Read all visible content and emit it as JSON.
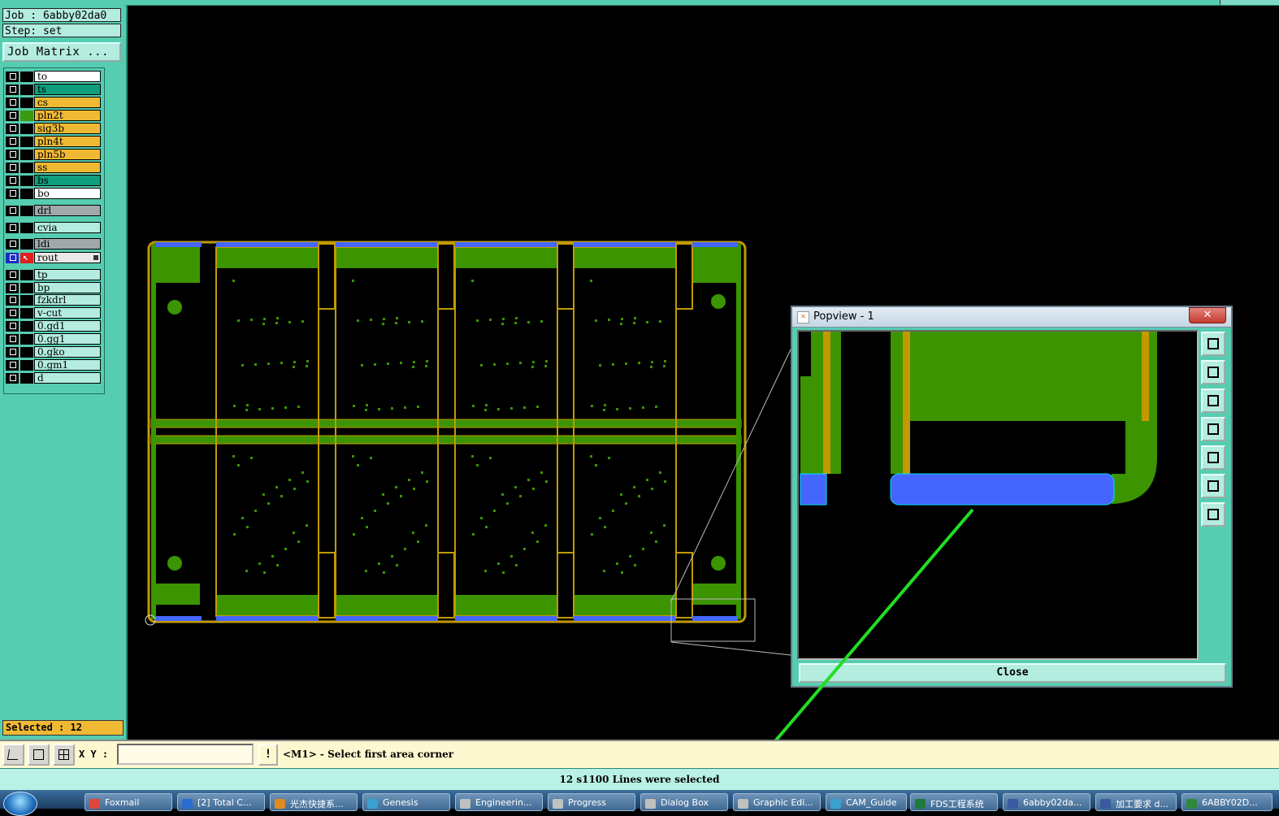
{
  "header": {
    "job_label": "Job : 6abby02da0",
    "step_label": "Step: set",
    "job_matrix_button": "Job Matrix ..."
  },
  "layers": [
    {
      "name": "to",
      "color": "#ffffff"
    },
    {
      "name": "ts",
      "color": "#0f9e7e"
    },
    {
      "name": "cs",
      "color": "#f0b934"
    },
    {
      "name": "pln2t",
      "color": "#f0b934",
      "swatch": "#3a9a10"
    },
    {
      "name": "sig3b",
      "color": "#f0b934"
    },
    {
      "name": "pln4t",
      "color": "#f0b934"
    },
    {
      "name": "pln5b",
      "color": "#f0b934"
    },
    {
      "name": "ss",
      "color": "#f0b934"
    },
    {
      "name": "bs",
      "color": "#0f9e7e"
    },
    {
      "name": "bo",
      "color": "#ffffff"
    },
    {
      "name": "drl",
      "color": "#a0a8aa"
    },
    {
      "name": "cvia",
      "color": "#b4ece0"
    },
    {
      "name": "ldi",
      "color": "#a0a8aa"
    },
    {
      "name": "rout",
      "color": "#e8e8e8",
      "active": true
    },
    {
      "name": "tp",
      "color": "#b4ece0"
    },
    {
      "name": "bp",
      "color": "#b4ece0"
    },
    {
      "name": "fzkdrl",
      "color": "#b4ece0"
    },
    {
      "name": "v-cut",
      "color": "#b4ece0"
    },
    {
      "name": "0.gd1",
      "color": "#b4ece0"
    },
    {
      "name": "0.gg1",
      "color": "#b4ece0"
    },
    {
      "name": "0.gko",
      "color": "#b4ece0"
    },
    {
      "name": "0.gm1",
      "color": "#b4ece0"
    },
    {
      "name": "d",
      "color": "#b4ece0"
    }
  ],
  "selected_label": "Selected : 12",
  "popview": {
    "title": "Popview - 1",
    "close_button": "Close",
    "tool_icons": [
      "zoom-window-icon",
      "pan-up-icon",
      "pan-down-icon",
      "pan-left-icon",
      "pan-right-icon",
      "zoom-out-icon",
      "zoom-home-icon"
    ]
  },
  "command": {
    "xy_label": "X Y :",
    "xy_value": "",
    "warn_label": "!",
    "prompt": "<M1> - Select first area corner"
  },
  "status_message": "12 s1100 Lines were selected",
  "taskbar": [
    {
      "label": "Foxmail",
      "icon_color": "#e0443a"
    },
    {
      "label": "[2] Total C...",
      "icon_color": "#2b6cd0"
    },
    {
      "label": "光杰快捷系...",
      "icon_color": "#e08a20"
    },
    {
      "label": "Genesis",
      "icon_color": "#3aa0d0"
    },
    {
      "label": "Engineerin...",
      "icon_color": "#c0c0c0"
    },
    {
      "label": "Progress",
      "icon_color": "#c0c0c0"
    },
    {
      "label": "Dialog Box",
      "icon_color": "#c0c0c0"
    },
    {
      "label": "Graphic Edi...",
      "icon_color": "#c0c0c0"
    },
    {
      "label": "CAM_Guide",
      "icon_color": "#3aa0d0"
    },
    {
      "label": "FDS工程系统",
      "icon_color": "#1e7a3a"
    },
    {
      "label": "6abby02da...",
      "icon_color": "#3a5aa0"
    },
    {
      "label": "加工要求 d...",
      "icon_color": "#3a5aa0"
    },
    {
      "label": "6ABBY02D...",
      "icon_color": "#2e8a3a"
    }
  ],
  "colors": {
    "board_fill": "#3c9400",
    "board_outline": "#c29a00",
    "rout_highlight": "#4466ff",
    "arrow": "#22dd22",
    "panel_bg": "#56cdb1"
  }
}
